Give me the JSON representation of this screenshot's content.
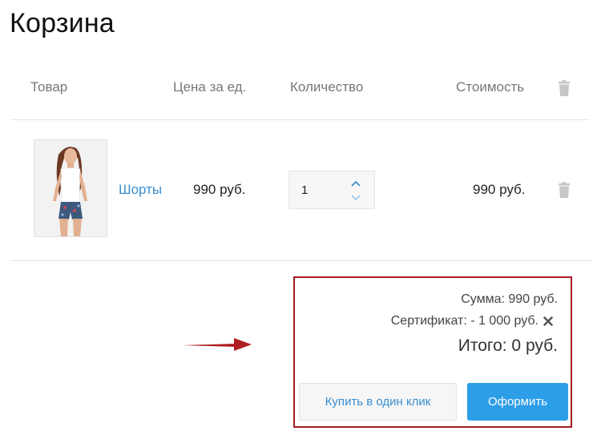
{
  "page": {
    "title": "Корзина"
  },
  "table": {
    "headers": {
      "product": "Товар",
      "unit_price": "Цена за ед.",
      "quantity": "Количество",
      "cost": "Стоимость",
      "delete_icon": "trash-icon"
    },
    "rows": [
      {
        "image_icon": "product-photo",
        "name": "Шорты",
        "unit_price": "990 руб.",
        "quantity": "1",
        "cost": "990 руб.",
        "delete_icon": "trash-icon"
      }
    ]
  },
  "summary": {
    "sum": "Сумма: 990 руб.",
    "certificate": "Сертификат: - 1 000 руб.",
    "certificate_remove_icon": "close-icon",
    "total": "Итого: 0 руб.",
    "one_click_label": "Купить в один клик",
    "checkout_label": "Оформить"
  },
  "colors": {
    "link": "#3a8ed0",
    "primary_button": "#2d9ee8",
    "highlight_border": "#a51d21",
    "arrow": "#b01e22"
  }
}
